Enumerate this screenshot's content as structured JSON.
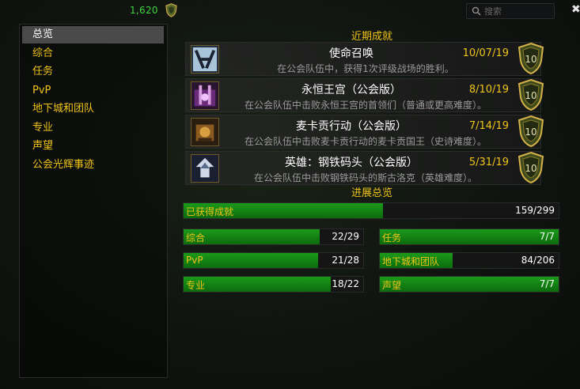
{
  "header": {
    "points": "1,620",
    "search_placeholder": "搜索",
    "close_symbol": "✖"
  },
  "sidebar": {
    "items": [
      {
        "label": "总览",
        "active": true
      },
      {
        "label": "综合"
      },
      {
        "label": "任务"
      },
      {
        "label": "PvP"
      },
      {
        "label": "地下城和团队"
      },
      {
        "label": "专业"
      },
      {
        "label": "声望"
      },
      {
        "label": "公会光辉事迹"
      }
    ]
  },
  "recent": {
    "title": "近期成就",
    "items": [
      {
        "title": "使命召唤",
        "date": "10/07/19",
        "desc": "在公会队伍中，获得1次评级战场的胜利。",
        "points": "10"
      },
      {
        "title": "永恒王宫（公会版）",
        "date": "8/10/19",
        "desc": "在公会队伍中击败永恒王宫的首领们（普通或更高难度）。",
        "points": "10"
      },
      {
        "title": "麦卡贡行动（公会版）",
        "date": "7/14/19",
        "desc": "在公会队伍中击败麦卡贡行动的麦卡贡国王（史诗难度）。",
        "points": "10"
      },
      {
        "title": "英雄：钢铁码头（公会版）",
        "date": "5/31/19",
        "desc": "在公会队伍中击败钢铁码头的斯古洛克（英雄难度）。",
        "points": "10"
      }
    ]
  },
  "progress": {
    "title": "进展总览",
    "total": {
      "label": "已获得成就",
      "value": "159/299",
      "fraction": 0.532
    },
    "categories": [
      {
        "label": "综合",
        "value": "22/29",
        "fraction": 0.759
      },
      {
        "label": "任务",
        "value": "7/7",
        "fraction": 1.0
      },
      {
        "label": "PvP",
        "value": "21/28",
        "fraction": 0.75
      },
      {
        "label": "地下城和团队",
        "value": "84/206",
        "fraction": 0.408
      },
      {
        "label": "专业",
        "value": "18/22",
        "fraction": 0.818
      },
      {
        "label": "声望",
        "value": "7/7",
        "fraction": 1.0
      }
    ]
  },
  "colors": {
    "gold_text": "#f0c419",
    "green_bar": "#1a9a1a",
    "points_green": "#3ed43e"
  },
  "icons": {
    "points_icon": "guild-shield-icon",
    "search_icon": "search-icon",
    "close_icon": "close-icon"
  }
}
